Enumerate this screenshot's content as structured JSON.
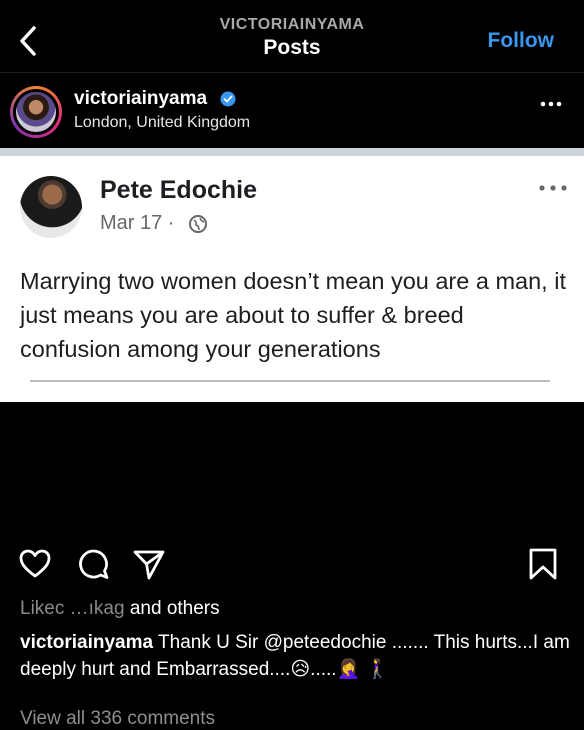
{
  "header": {
    "account_label": "VICTORIAINYAMA",
    "title": "Posts",
    "follow_label": "Follow"
  },
  "post": {
    "username": "victoriainyama",
    "location": "London, United Kingdom",
    "image": {
      "author": "Pete Edochie",
      "date": "Mar 17 ·",
      "text": "Marrying two women doesn’t mean you are a man, it just means you are about to suffer & breed confusion among your generations"
    },
    "liked_prefix": "Likec",
    "liked_mid": "…ıkag",
    "liked_suffix": "and others",
    "caption_user": "victoriainyama",
    "caption_text": "Thank U Sir @peteedochie ....... This hurts...I am deeply hurt and Embarrassed....😥.....🤦‍♀️ 🚶‍♀️",
    "view_comments": "View all 336 comments"
  },
  "colors": {
    "accent": "#3897f0",
    "background": "#000000",
    "verified": "#3897f0"
  },
  "icons": [
    "back-arrow-icon",
    "verified-badge-icon",
    "more-options-icon",
    "globe-icon",
    "heart-icon",
    "comment-icon",
    "share-icon",
    "bookmark-icon"
  ]
}
